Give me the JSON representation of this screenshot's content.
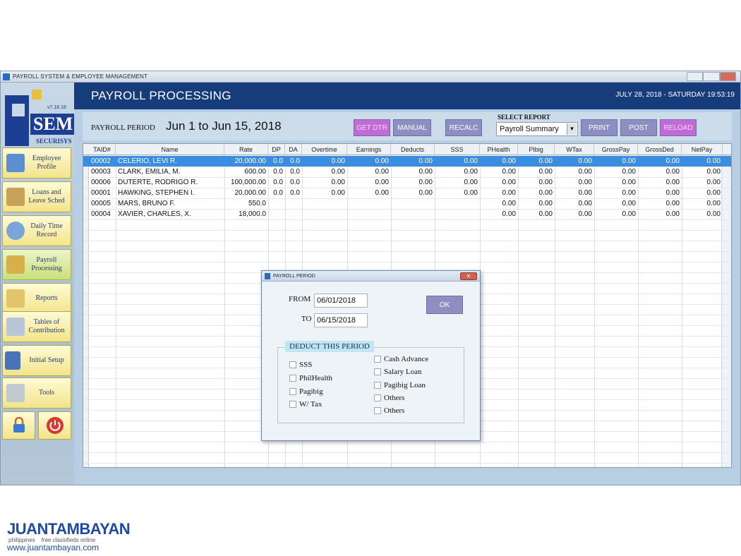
{
  "window": {
    "title": "PAYROLL SYSTEM & EMPLOYEE MANAGEMENT"
  },
  "logo": {
    "version": "v7.18.18",
    "name": "SEM",
    "company": "SECURISYS"
  },
  "sidebar": {
    "items": [
      {
        "label_line1": "Employee",
        "label_line2": "Profile",
        "icon": "employee-icon"
      },
      {
        "label_line1": "Loans and",
        "label_line2": "Leave Sched",
        "icon": "loans-icon"
      },
      {
        "label_line1": "Daily Time",
        "label_line2": "Record",
        "icon": "clock-icon"
      },
      {
        "label_line1": "Payroll",
        "label_line2": "Processing",
        "icon": "payroll-icon"
      },
      {
        "label_line1": "Reports",
        "label_line2": "",
        "icon": "reports-icon"
      },
      {
        "label_line1": "Tables of",
        "label_line2": "Contribution",
        "icon": "tables-icon"
      },
      {
        "label_line1": "Initial Setup",
        "label_line2": "",
        "icon": "building-icon"
      },
      {
        "label_line1": "Tools",
        "label_line2": "",
        "icon": "tools-icon"
      }
    ]
  },
  "header": {
    "title": "PAYROLL PROCESSING",
    "datetime": "JULY 28, 2018 - SATURDAY 19:53:19"
  },
  "toolbar": {
    "period_label": "PAYROLL PERIOD",
    "period_value": "Jun 1 to Jun 15, 2018",
    "get_dtr": "GET DTR",
    "manual": "MANUAL",
    "recalc": "RECALC",
    "select_report_label": "SELECT REPORT",
    "select_report_value": "Payroll Summary",
    "print": "PRINT",
    "post": "POST",
    "reload": "RELOAD"
  },
  "table": {
    "columns": [
      "TAID#",
      "Name",
      "Rate",
      "DP",
      "DA",
      "Overtime",
      "Earnings",
      "Deducts",
      "SSS",
      "PHealth",
      "PIbig",
      "WTax",
      "GrossPay",
      "GrossDed",
      "NetPay"
    ],
    "rows": [
      [
        "00002",
        "CELERIO, LEVI R.",
        "20,000.00",
        "0.0",
        "0.0",
        "0.00",
        "0.00",
        "0.00",
        "0.00",
        "0.00",
        "0.00",
        "0.00",
        "0.00",
        "0.00",
        "0.00"
      ],
      [
        "00003",
        "CLARK, EMILIA, M.",
        "600.00",
        "0.0",
        "0.0",
        "0.00",
        "0.00",
        "0.00",
        "0.00",
        "0.00",
        "0.00",
        "0.00",
        "0.00",
        "0.00",
        "0.00"
      ],
      [
        "00006",
        "DUTERTE, RODRIGO R.",
        "100,000.00",
        "0.0",
        "0.0",
        "0.00",
        "0.00",
        "0.00",
        "0.00",
        "0.00",
        "0.00",
        "0.00",
        "0.00",
        "0.00",
        "0.00"
      ],
      [
        "00001",
        "HAWKING, STEPHEN I.",
        "20,000.00",
        "0.0",
        "0.0",
        "0.00",
        "0.00",
        "0.00",
        "0.00",
        "0.00",
        "0.00",
        "0.00",
        "0.00",
        "0.00",
        "0.00"
      ],
      [
        "00005",
        "MARS, BRUNO F.",
        "550.0",
        "",
        "",
        "",
        "",
        "",
        "",
        "0.00",
        "0.00",
        "0.00",
        "0.00",
        "0.00",
        "0.00"
      ],
      [
        "00004",
        "XAVIER, CHARLES, X.",
        "18,000.0",
        "",
        "",
        "",
        "",
        "",
        "",
        "0.00",
        "0.00",
        "0.00",
        "0.00",
        "0.00",
        "0.00"
      ]
    ]
  },
  "dialog": {
    "title": "PAYROLL PERIOD",
    "from_label": "FROM",
    "from_value": "06/01/2018",
    "to_label": "TO",
    "to_value": "06/15/2018",
    "ok": "OK",
    "group_title": "DEDUCT THIS PERIOD",
    "left_checks": [
      "SSS",
      "PhilHealth",
      "Pagibig",
      "W/ Tax"
    ],
    "right_checks": [
      "Cash Advance",
      "Salary Loan",
      "Pagibig Loan",
      "Others",
      "Others"
    ]
  },
  "watermark": {
    "brand": "JUANTAMBAYAN",
    "tag_left": "philippines",
    "tag_right": "free classifieds online",
    "url": "www.juantambayan.com"
  },
  "colors": {
    "header_bg": "#173c7c",
    "selected_row": "#3b8edf",
    "button_purple": "#8d8fc3",
    "button_magenta": "#c26ad8",
    "nav_yellow": "#f2e48a"
  }
}
